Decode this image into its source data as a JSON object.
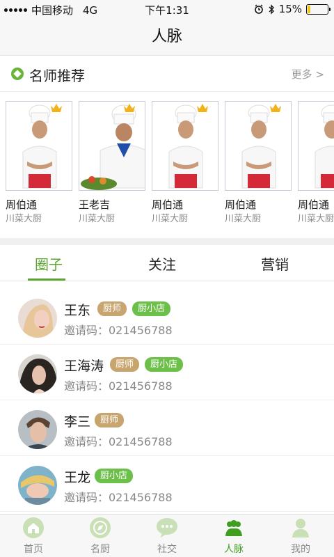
{
  "status_bar": {
    "carrier": "中国移动",
    "network": "4G",
    "time": "下午1:31",
    "battery_percent": "15%",
    "battery_level": 0.15
  },
  "nav": {
    "title": "人脉"
  },
  "recommend": {
    "title": "名师推荐",
    "more": "更多 >"
  },
  "chefs": [
    {
      "name": "周伯通",
      "title": "川菜大厨"
    },
    {
      "name": "王老吉",
      "title": "川菜大厨"
    },
    {
      "name": "周伯通",
      "title": "川菜大厨"
    },
    {
      "name": "周伯通",
      "title": "川菜大厨"
    },
    {
      "name": "周伯通",
      "title": "川菜大厨"
    }
  ],
  "tabs": [
    {
      "label": "圈子",
      "active": true
    },
    {
      "label": "关注",
      "active": false
    },
    {
      "label": "营销",
      "active": false
    }
  ],
  "contacts": [
    {
      "name": "王东",
      "badges": [
        "厨师",
        "厨小店"
      ],
      "invite": "邀请码：021456788"
    },
    {
      "name": "王海涛",
      "badges": [
        "厨师",
        "厨小店"
      ],
      "invite": "邀请码：021456788"
    },
    {
      "name": "李三",
      "badges": [
        "厨师"
      ],
      "invite": "邀请码：021456788"
    },
    {
      "name": "王龙",
      "badges": [
        "厨小店"
      ],
      "invite": "邀请码：021456788"
    }
  ],
  "tabbar": [
    {
      "label": "首页",
      "icon": "home-icon",
      "active": false
    },
    {
      "label": "名厨",
      "icon": "compass-icon",
      "active": false
    },
    {
      "label": "社交",
      "icon": "chat-bubble-icon",
      "active": false
    },
    {
      "label": "人脉",
      "icon": "people-icon",
      "active": true
    },
    {
      "label": "我的",
      "icon": "user-icon",
      "active": false
    }
  ],
  "colors": {
    "accent": "#5ca630",
    "badge_chef": "#c8a46e",
    "badge_shop": "#6cc04a",
    "battery": "#f0c419"
  }
}
